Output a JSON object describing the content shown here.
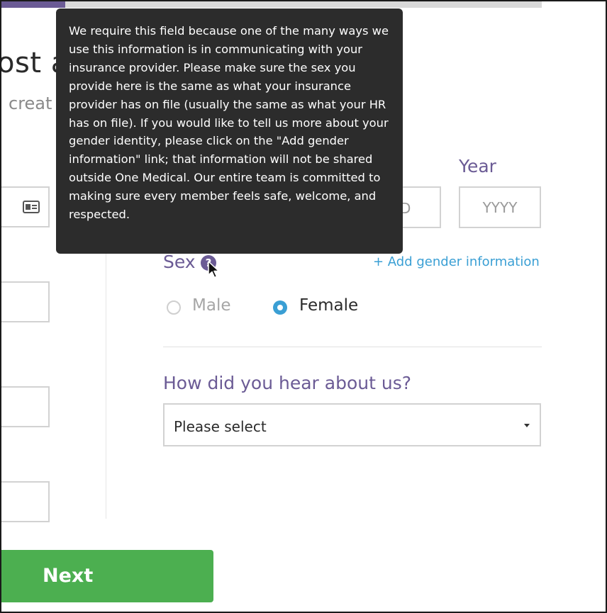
{
  "header": {
    "title_partial": "ost a",
    "subtitle_partial": "creat"
  },
  "progress": {
    "fraction": 0.12
  },
  "tooltip": {
    "text": "We require this field because one of the many ways we use this information is in communicating with your insurance provider. Please make sure the sex you provide here is the same as what your insurance provider has on file (usually the same as what your HR has on file). If you would like to tell us more about your gender identity, please click on the \"Add gender information\" link; that information will not be shared outside One Medical. Our entire team is committed to making sure every member feels safe, welcome, and respected."
  },
  "birthdate": {
    "day_placeholder_partial": "D",
    "year_label": "Year",
    "year_placeholder": "YYYY"
  },
  "sex": {
    "label": "Sex",
    "help_icon_glyph": "?",
    "add_gender_link": "+ Add gender information",
    "options": [
      "Male",
      "Female"
    ],
    "selected": "Female"
  },
  "referral": {
    "label": "How did you hear about us?",
    "select_value": "Please select"
  },
  "footer": {
    "next_label": "Next"
  },
  "colors": {
    "accent_purple": "#6b5b95",
    "link_blue": "#3a9fd4",
    "button_green": "#4caf50",
    "tooltip_bg": "#2c2c2c"
  }
}
